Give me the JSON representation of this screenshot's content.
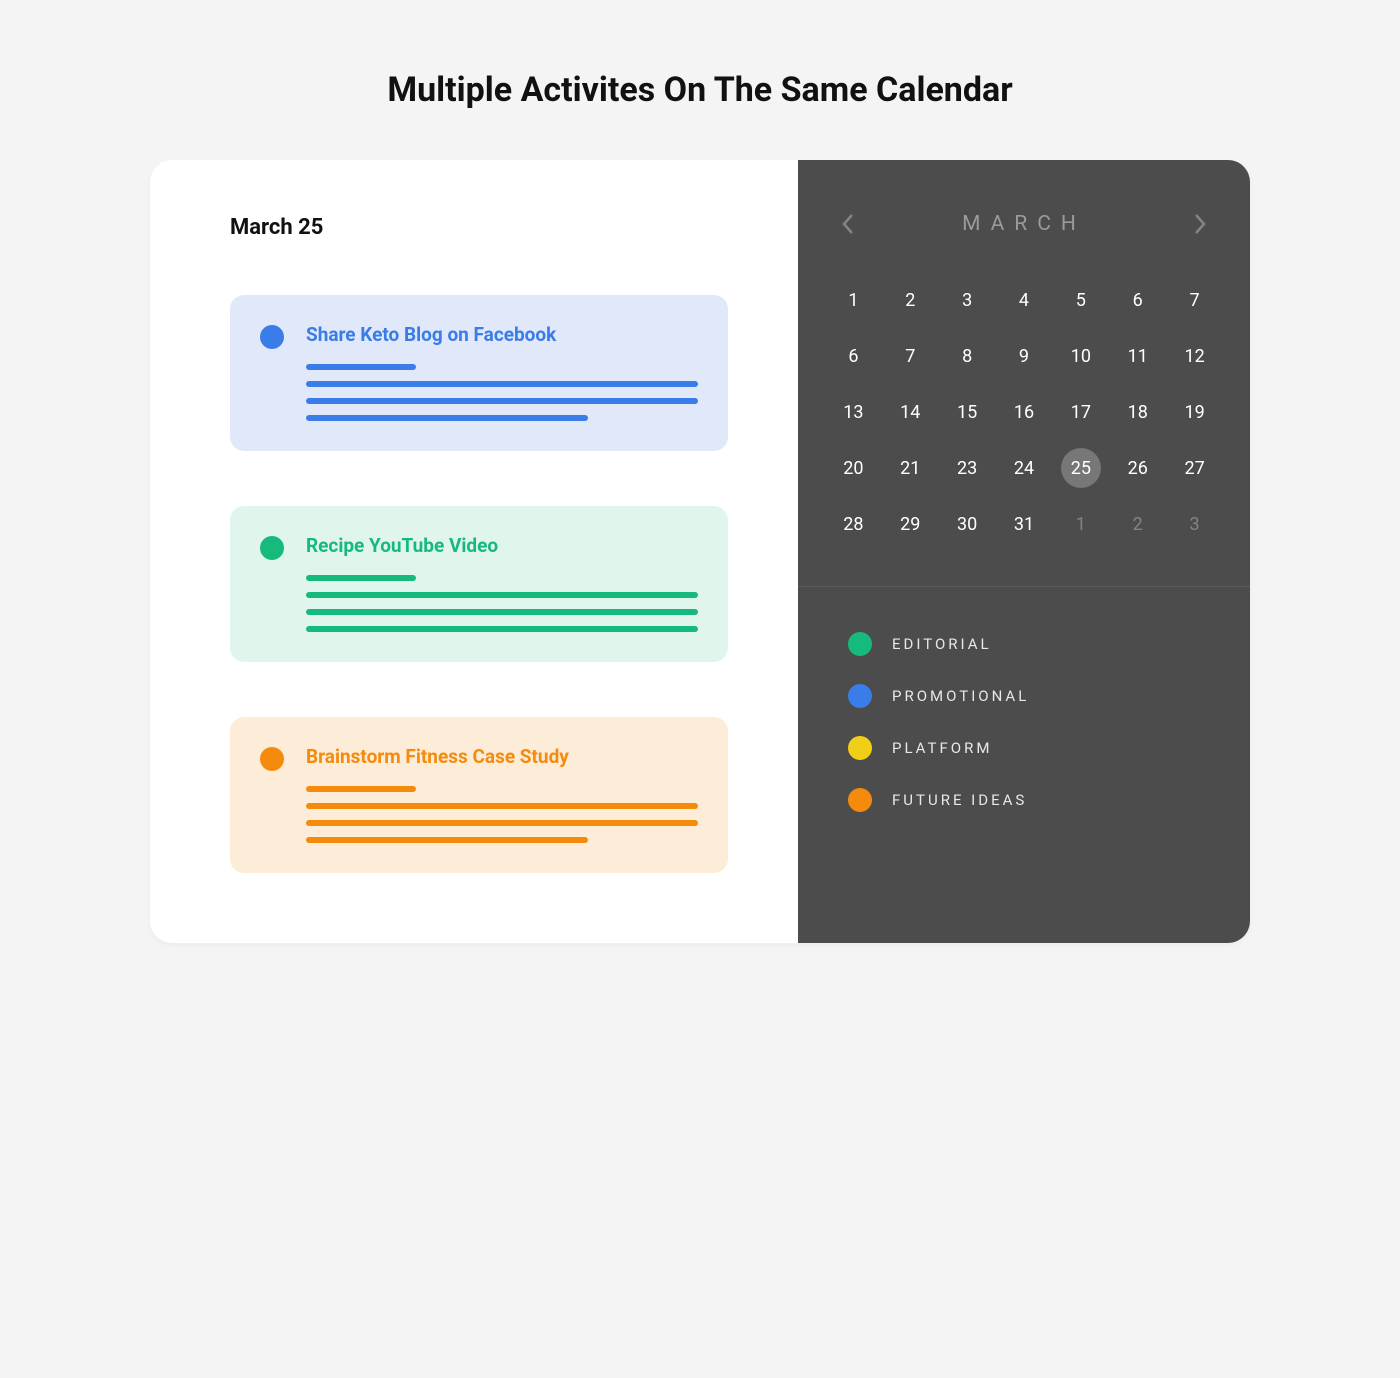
{
  "page": {
    "title": "Multiple Activites On The Same Calendar"
  },
  "left": {
    "date_heading": "March 25",
    "activities": [
      {
        "title": "Share Keto Blog on Facebook",
        "color": "blue"
      },
      {
        "title": "Recipe YouTube Video",
        "color": "green"
      },
      {
        "title": "Brainstorm Fitness Case Study",
        "color": "orange"
      }
    ]
  },
  "calendar": {
    "month": "MARCH",
    "selected_day": 25,
    "days": [
      {
        "n": "1"
      },
      {
        "n": "2"
      },
      {
        "n": "3"
      },
      {
        "n": "4"
      },
      {
        "n": "5"
      },
      {
        "n": "6"
      },
      {
        "n": "7"
      },
      {
        "n": "6"
      },
      {
        "n": "7"
      },
      {
        "n": "8"
      },
      {
        "n": "9"
      },
      {
        "n": "10"
      },
      {
        "n": "11"
      },
      {
        "n": "12"
      },
      {
        "n": "13"
      },
      {
        "n": "14"
      },
      {
        "n": "15"
      },
      {
        "n": "16"
      },
      {
        "n": "17"
      },
      {
        "n": "18"
      },
      {
        "n": "19"
      },
      {
        "n": "20"
      },
      {
        "n": "21"
      },
      {
        "n": "23"
      },
      {
        "n": "24"
      },
      {
        "n": "25",
        "selected": true
      },
      {
        "n": "26"
      },
      {
        "n": "27"
      },
      {
        "n": "28"
      },
      {
        "n": "29"
      },
      {
        "n": "30"
      },
      {
        "n": "31"
      },
      {
        "n": "1",
        "dim": true
      },
      {
        "n": "2",
        "dim": true
      },
      {
        "n": "3",
        "dim": true
      }
    ]
  },
  "legend": [
    {
      "label": "EDITORIAL",
      "color": "#17ba7d"
    },
    {
      "label": "PROMOTIONAL",
      "color": "#3a7ce8"
    },
    {
      "label": "PLATFORM",
      "color": "#f2cf17"
    },
    {
      "label": "FUTURE IDEAS",
      "color": "#f58b0c"
    }
  ]
}
